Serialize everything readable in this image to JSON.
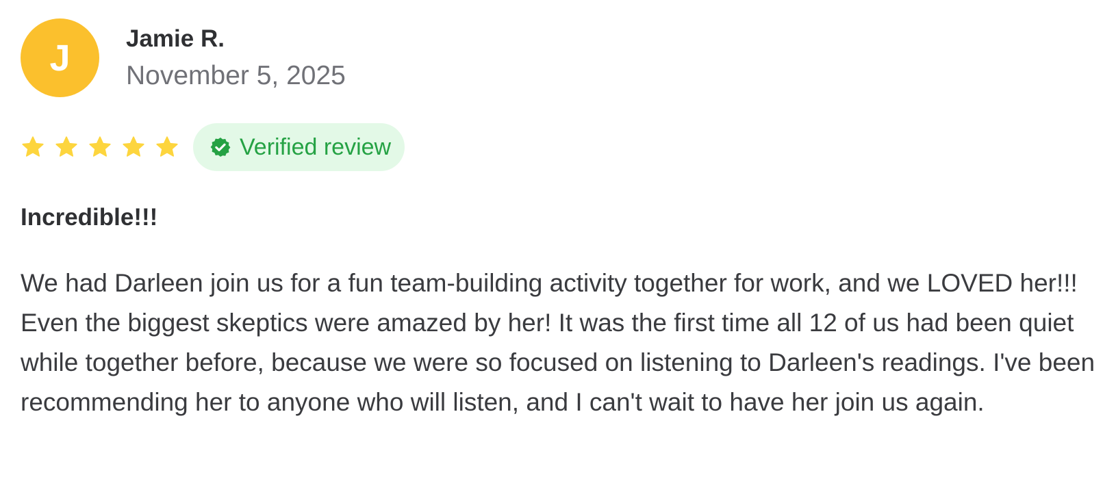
{
  "review": {
    "author_initial": "J",
    "author_name": "Jamie R.",
    "date": "November 5, 2025",
    "rating": 5,
    "rating_max": 5,
    "verified_label": "Verified review",
    "title": "Incredible!!!",
    "body": "We had Darleen join us for a fun team-building activity together for work, and we LOVED her!!! Even the biggest skeptics were amazed by her! It was the first time all 12 of us had been quiet while together before, because we were so focused on listening to Darleen's readings. I've been recommending her to anyone who will listen, and I can't wait to have her join us again."
  },
  "icons": {
    "star": "star-icon",
    "verified": "verified-check-icon"
  },
  "colors": {
    "avatar_bg": "#fbc02d",
    "star": "#fdd53e",
    "badge_bg": "#e3f9e7",
    "badge_text": "#25a244",
    "text_primary": "#2f3033",
    "text_muted": "#707177"
  }
}
